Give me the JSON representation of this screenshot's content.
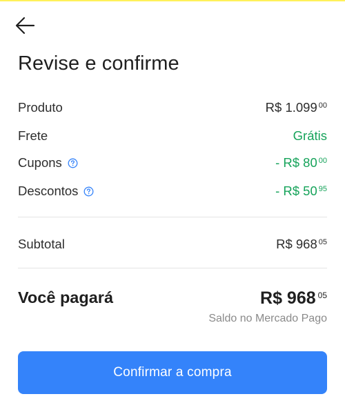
{
  "header": {
    "title": "Revise e confirme"
  },
  "summary": {
    "product": {
      "label": "Produto",
      "amount": "R$ 1.099",
      "cents": "00"
    },
    "shipping": {
      "label": "Frete",
      "value": "Grátis"
    },
    "coupons": {
      "label": "Cupons",
      "amount": "- R$ 80",
      "cents": "00"
    },
    "discounts": {
      "label": "Descontos",
      "amount": "- R$ 50",
      "cents": "95"
    },
    "subtotal": {
      "label": "Subtotal",
      "amount": "R$ 968",
      "cents": "05"
    }
  },
  "total": {
    "label": "Você pagará",
    "amount": "R$ 968",
    "cents": "05",
    "source": "Saldo no Mercado Pago"
  },
  "actions": {
    "confirm_label": "Confirmar a compra"
  },
  "colors": {
    "accent": "#3483fa",
    "positive": "#16a35a",
    "brand_bar": "#fff159"
  },
  "icons": {
    "back": "arrow-left-icon",
    "help": "help-circle-icon"
  }
}
